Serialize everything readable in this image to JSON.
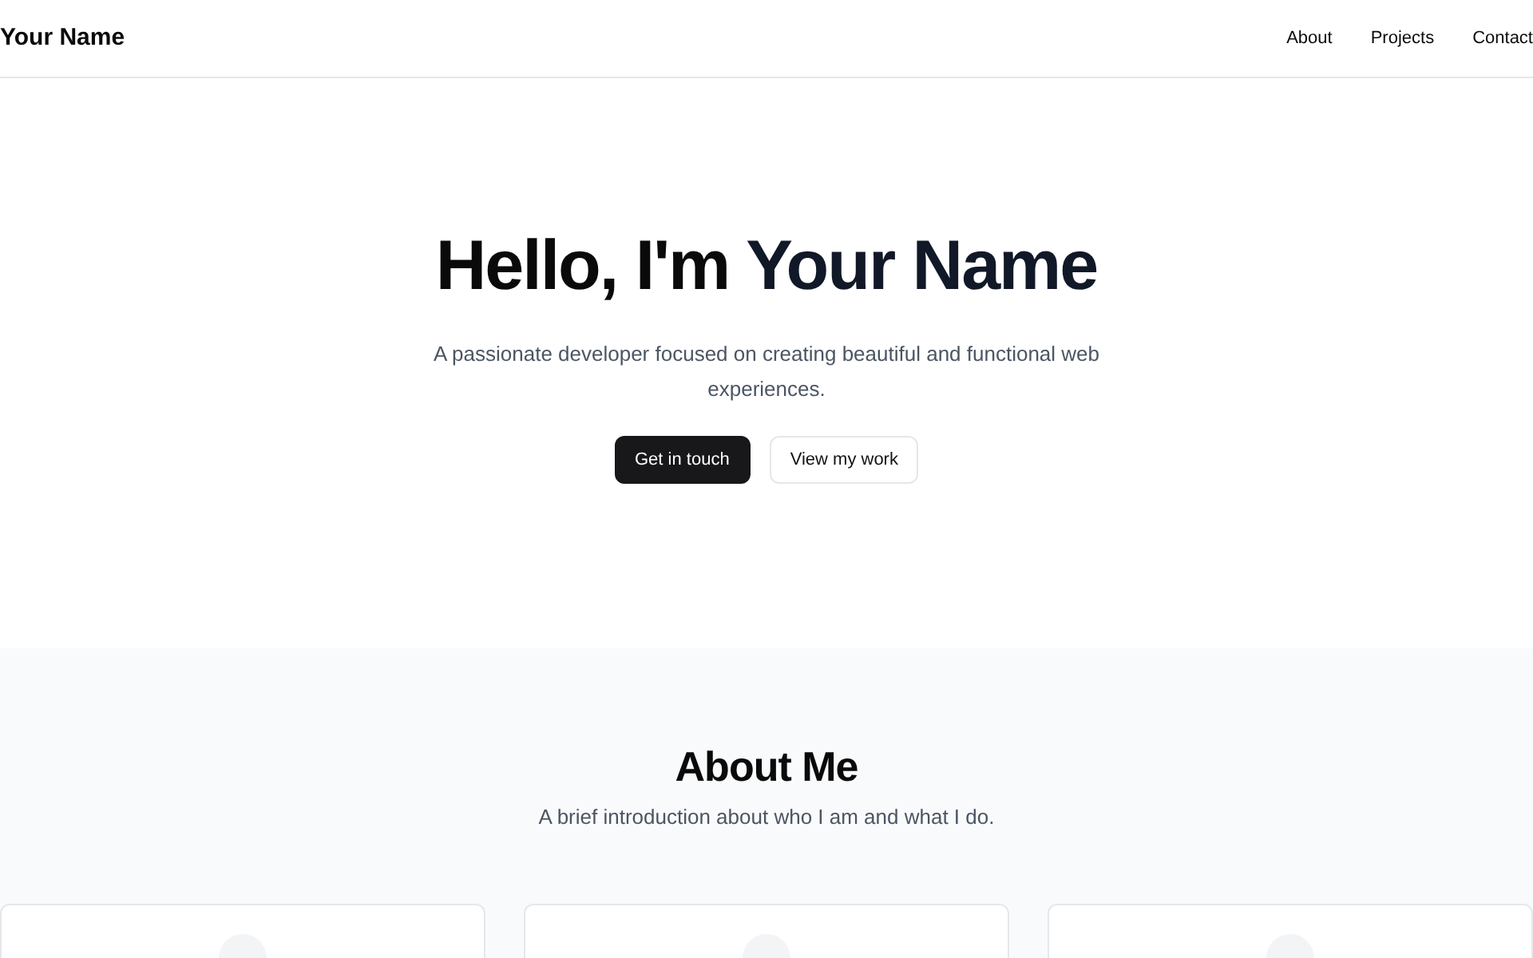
{
  "header": {
    "brand": "Your Name",
    "nav": [
      {
        "label": "About"
      },
      {
        "label": "Projects"
      },
      {
        "label": "Contact"
      }
    ]
  },
  "hero": {
    "title": "Hello, I'm ",
    "title_highlight": "Your Name",
    "subtitle": "A passionate developer focused on creating beautiful and functional web experiences.",
    "buttons": [
      {
        "label": "Get in touch",
        "kind": "primary"
      },
      {
        "label": "View my work",
        "kind": "outline"
      }
    ]
  },
  "about": {
    "title": "About Me",
    "subtitle": "A brief introduction about who I am and what I do.",
    "cards": [
      {
        "kind": "icon"
      },
      {
        "kind": "icon"
      },
      {
        "kind": "icon"
      }
    ]
  }
}
